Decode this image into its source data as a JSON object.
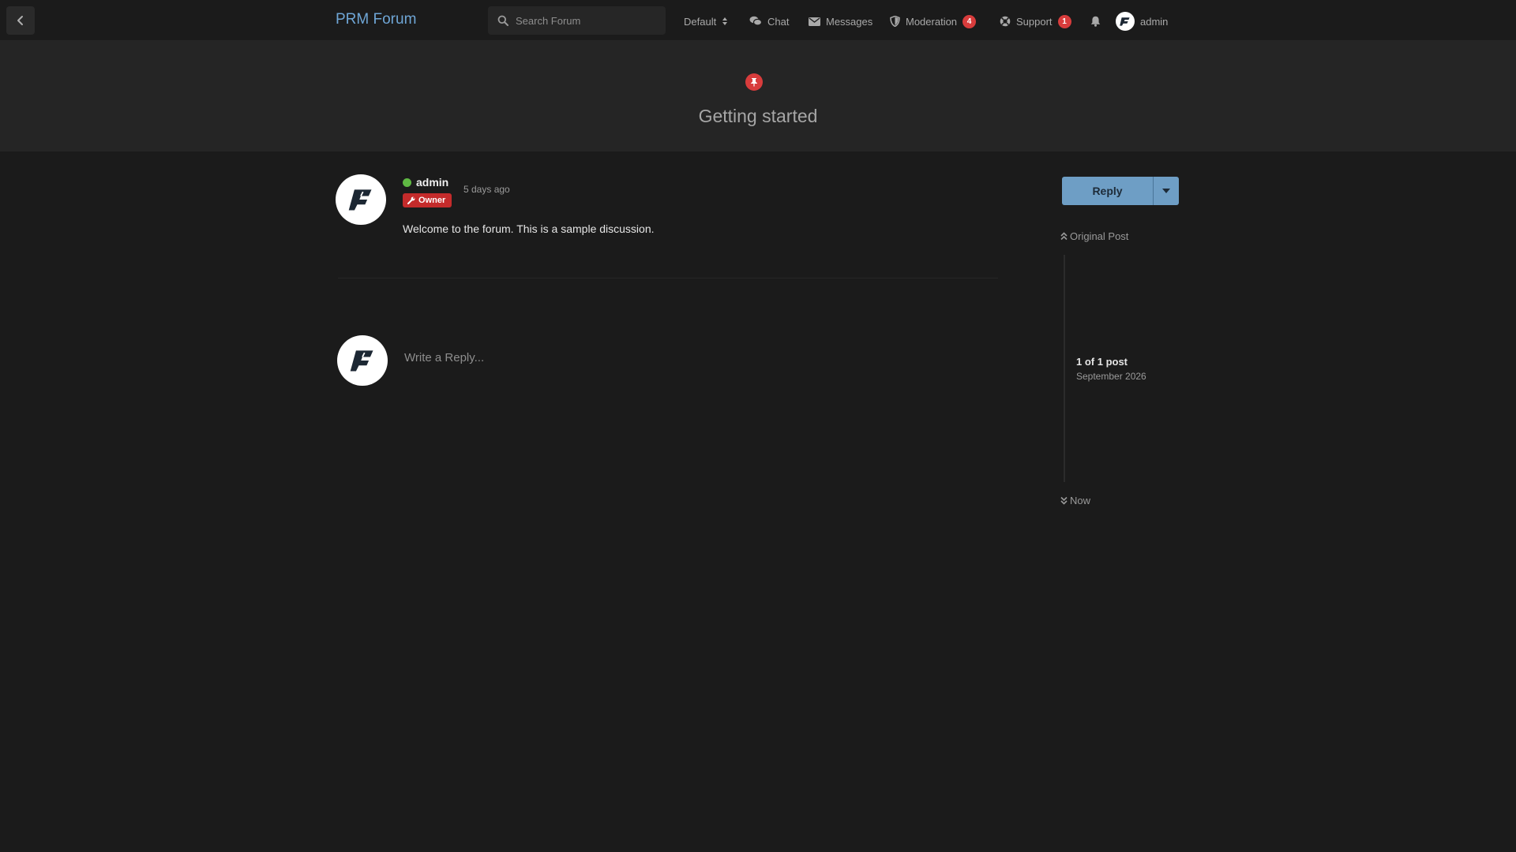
{
  "header": {
    "site_title": "PRM Forum",
    "search": {
      "placeholder": "Search Forum"
    },
    "nav": {
      "default": "Default",
      "chat": "Chat",
      "messages": "Messages",
      "moderation": "Moderation",
      "moderation_count": "4",
      "support": "Support",
      "support_count": "1",
      "username": "admin"
    }
  },
  "discussion": {
    "title": "Getting started",
    "pinned": true
  },
  "post": {
    "author": "admin",
    "online": true,
    "badge": "Owner",
    "time": "5 days ago",
    "body": "Welcome to the forum. This is a sample discussion."
  },
  "composer": {
    "placeholder": "Write a Reply..."
  },
  "sidebar": {
    "reply_label": "Reply",
    "original_post": "Original Post",
    "count": "1 of 1 post",
    "date": "September 2026",
    "now": "Now"
  },
  "colors": {
    "background": "#1b1b1b",
    "hero": "#252525",
    "accent": "#6fa6d6",
    "button": "#6e9ec5",
    "danger": "#d83c3c",
    "online": "#5fb843"
  }
}
